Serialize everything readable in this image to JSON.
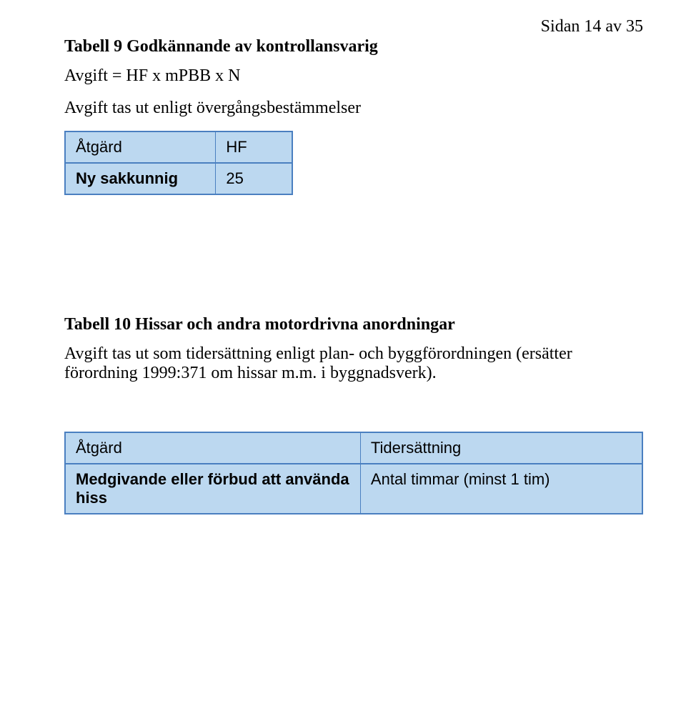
{
  "page_number": "Sidan 14 av 35",
  "section9": {
    "heading": "Tabell 9 Godkännande av kontrollansvarig",
    "formula": "Avgift = HF x mPBB x N",
    "note": "Avgift tas ut enligt övergångsbestämmelser",
    "table": {
      "headers": [
        "Åtgärd",
        "HF"
      ],
      "rows": [
        {
          "label": "Ny sakkunnig",
          "value": "25"
        }
      ]
    }
  },
  "section10": {
    "heading": "Tabell 10 Hissar och andra motordrivna anordningar",
    "note": "Avgift tas ut som tidersättning enligt plan- och byggförordningen (ersätter förordning 1999:371 om hissar m.m. i byggnadsverk).",
    "table": {
      "headers": [
        "Åtgärd",
        "Tidersättning"
      ],
      "rows": [
        {
          "label": "Medgivande eller förbud att använda hiss",
          "value": "Antal timmar (minst 1 tim)"
        }
      ]
    }
  }
}
